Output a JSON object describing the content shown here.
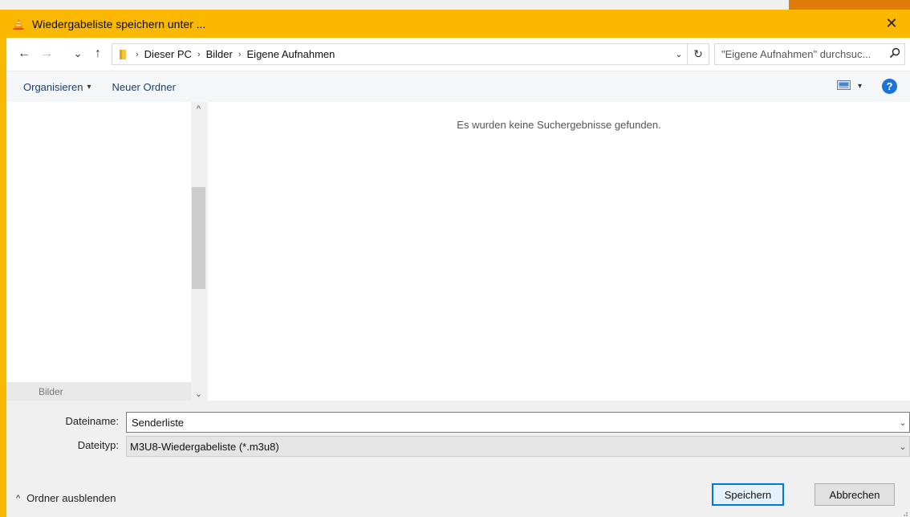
{
  "window": {
    "title": "Wiedergabeliste speichern unter ...",
    "accent_color": "#fbb800",
    "close_glyph": "✕"
  },
  "nav": {
    "back_glyph": "←",
    "forward_glyph": "→",
    "recent_glyph": "⌄",
    "up_glyph": "↑",
    "breadcrumbs": [
      "Dieser PC",
      "Bilder",
      "Eigene Aufnahmen"
    ],
    "breadcrumb_sep": "›",
    "dropdown_glyph": "⌄",
    "refresh_glyph": "↻",
    "search_placeholder": "\"Eigene Aufnahmen\" durchsuc...",
    "search_glyph": "⚲"
  },
  "toolbar": {
    "organize_label": "Organisieren",
    "organize_caret": "▾",
    "new_folder_label": "Neuer Ordner",
    "view_caret": "▾",
    "help_label": "?"
  },
  "nav_pane": {
    "scroll_up": "^",
    "scroll_down": "⌄",
    "partial_item": "Bilder"
  },
  "content": {
    "empty_message": "Es wurden keine Suchergebnisse gefunden."
  },
  "form": {
    "filename_label": "Dateiname:",
    "filename_value": "Senderliste",
    "filetype_label": "Dateityp:",
    "filetype_value": "M3U8-Wiedergabeliste (*.m3u8)",
    "chevron": "⌄"
  },
  "footer": {
    "hide_folders_glyph": "^",
    "hide_folders_label": "Ordner ausblenden",
    "save_label": "Speichern",
    "cancel_label": "Abbrechen"
  }
}
